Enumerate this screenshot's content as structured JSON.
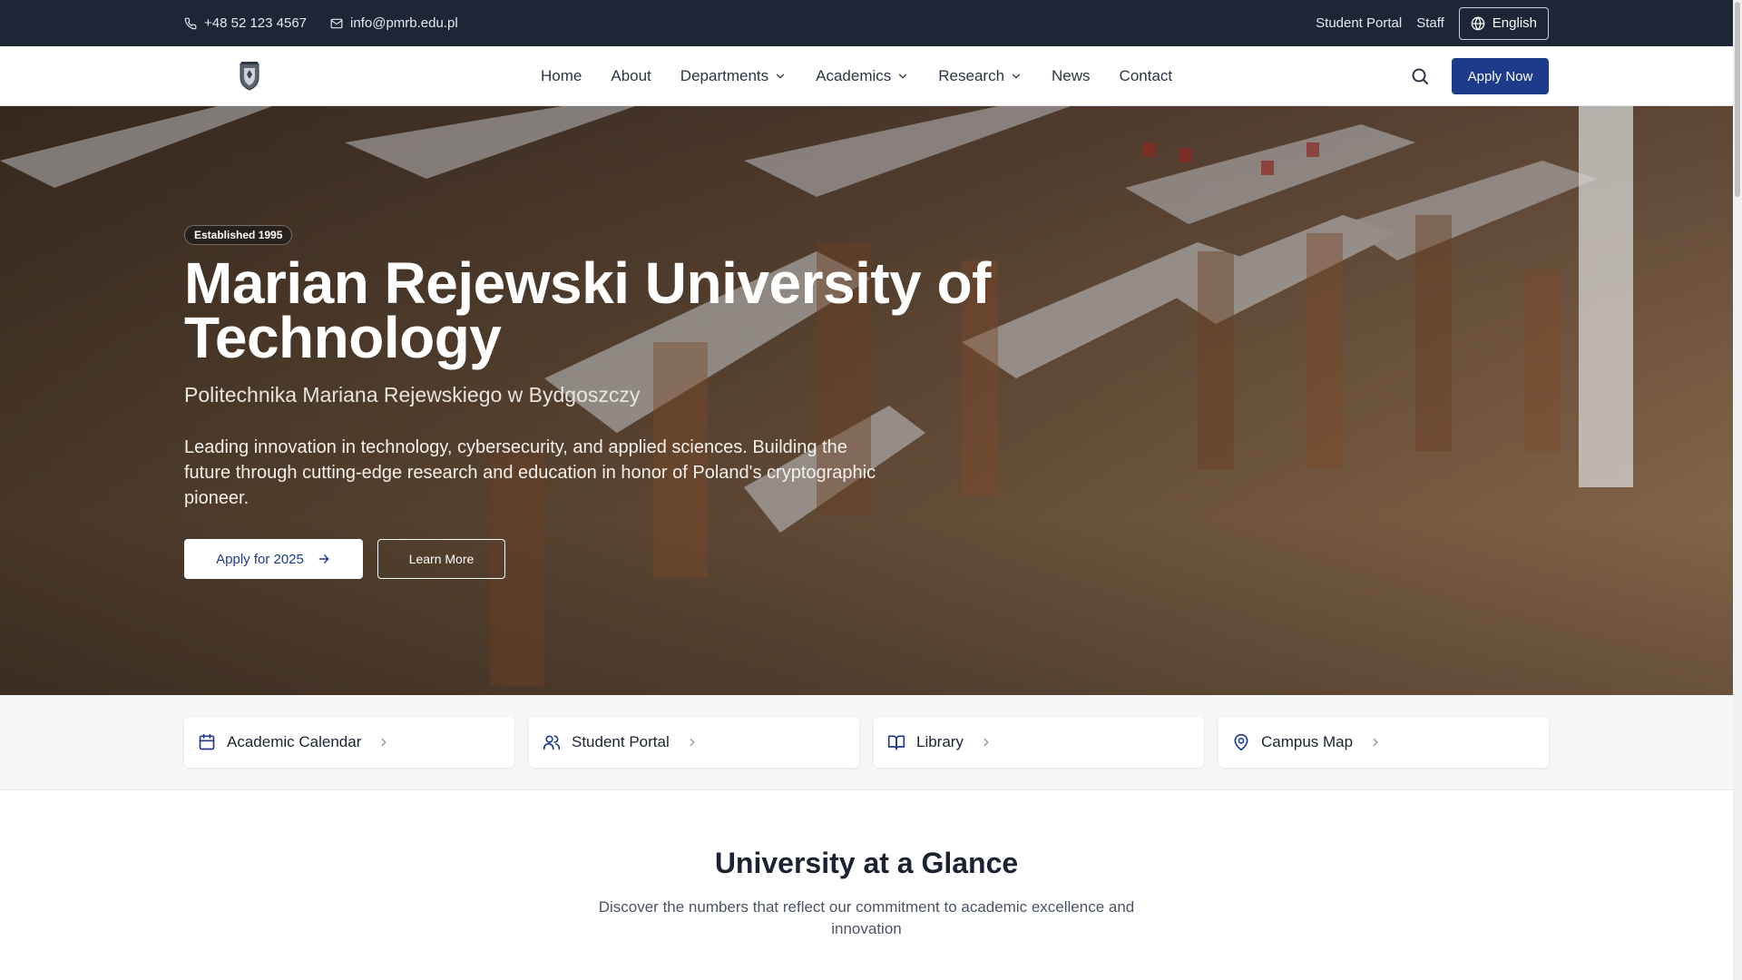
{
  "topbar": {
    "phone": "+48 52 123 4567",
    "email": "info@pmrb.edu.pl",
    "student_portal": "Student Portal",
    "staff": "Staff",
    "language": "English"
  },
  "nav": {
    "items": [
      {
        "label": "Home",
        "dropdown": false
      },
      {
        "label": "About",
        "dropdown": false
      },
      {
        "label": "Departments",
        "dropdown": true
      },
      {
        "label": "Academics",
        "dropdown": true
      },
      {
        "label": "Research",
        "dropdown": true
      },
      {
        "label": "News",
        "dropdown": false
      },
      {
        "label": "Contact",
        "dropdown": false
      }
    ],
    "apply_label": "Apply Now"
  },
  "hero": {
    "badge": "Established 1995",
    "title": "Marian Rejewski University of Technology",
    "subtitle": "Politechnika Mariana Rejewskiego w Bydgoszczy",
    "description": "Leading innovation in technology, cybersecurity, and applied sciences. Building the future through cutting-edge research and education in honor of Poland's cryptographic pioneer.",
    "primary_button": "Apply for 2025",
    "secondary_button": "Learn More"
  },
  "quick_links": [
    {
      "label": "Academic Calendar",
      "icon": "calendar-icon"
    },
    {
      "label": "Student Portal",
      "icon": "users-icon"
    },
    {
      "label": "Library",
      "icon": "book-icon"
    },
    {
      "label": "Campus Map",
      "icon": "map-pin-icon"
    }
  ],
  "glance": {
    "title": "University at a Glance",
    "subtitle": "Discover the numbers that reflect our commitment to academic excellence and innovation"
  },
  "colors": {
    "topbar_bg": "#1d2636",
    "brand_blue": "#1e3a8a",
    "quick_bg": "#f5f6f8"
  }
}
